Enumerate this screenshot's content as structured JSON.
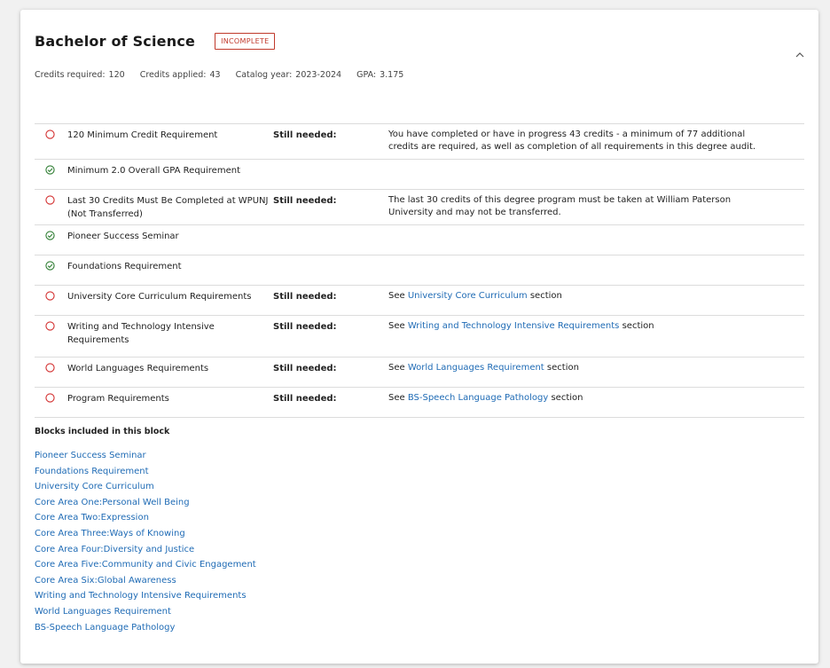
{
  "header": {
    "title": "Bachelor of Science",
    "badge": "INCOMPLETE"
  },
  "meta": {
    "credits_required_label": "Credits required:",
    "credits_required": "120",
    "credits_applied_label": "Credits applied:",
    "credits_applied": "43",
    "catalog_year_label": "Catalog year:",
    "catalog_year": "2023-2024",
    "gpa_label": "GPA:",
    "gpa": "3.175"
  },
  "requirements": [
    {
      "name": "120 Minimum Credit Requirement",
      "status": "incomplete",
      "still": "Still needed:",
      "desc": "You have completed or have in progress 43 credits - a minimum of 77 additional credits are required, as well as completion of all requirements in this degree audit."
    },
    {
      "name": "Minimum 2.0 Overall GPA Requirement",
      "status": "complete"
    },
    {
      "name": "Last 30 Credits Must Be Completed at WPUNJ (Not Transferred)",
      "status": "incomplete",
      "still": "Still needed:",
      "desc": "The last 30 credits of this degree program must be taken at William Paterson University and may not be transferred."
    },
    {
      "name": "Pioneer Success Seminar",
      "status": "complete"
    },
    {
      "name": "Foundations Requirement",
      "status": "complete"
    },
    {
      "name": "University Core Curriculum Requirements",
      "status": "incomplete",
      "still": "Still needed:",
      "see": "See",
      "link": "University Core Curriculum",
      "suffix": "section"
    },
    {
      "name": "Writing and Technology Intensive Requirements",
      "status": "incomplete",
      "still": "Still needed:",
      "see": "See",
      "link": "Writing and Technology Intensive Requirements",
      "suffix": "section"
    },
    {
      "name": "World Languages Requirements",
      "status": "incomplete",
      "still": "Still needed:",
      "see": "See",
      "link": "World Languages Requirement",
      "suffix": "section"
    },
    {
      "name": "Program Requirements",
      "status": "incomplete",
      "still": "Still needed:",
      "see": "See",
      "link": "BS-Speech Language Pathology",
      "suffix": "section"
    }
  ],
  "blocks": {
    "title": "Blocks included in this block",
    "items": [
      "Pioneer Success Seminar",
      "Foundations Requirement",
      "University Core Curriculum",
      "Core Area One:Personal Well Being",
      "Core Area Two:Expression",
      "Core Area Three:Ways of Knowing",
      "Core Area Four:Diversity and Justice",
      "Core Area Five:Community and Civic Engagement",
      "Core Area Six:Global Awareness",
      "Writing and Technology Intensive Requirements",
      "World Languages Requirement",
      "BS-Speech Language Pathology"
    ]
  },
  "icons": {
    "incomplete": "circle-outline-icon",
    "complete": "check-circle-icon",
    "collapse": "chevron-up-icon"
  },
  "colors": {
    "incomplete": "#d32f2f",
    "complete": "#2e7d32",
    "link": "#1f6bb5",
    "badge": "#c0392b"
  }
}
